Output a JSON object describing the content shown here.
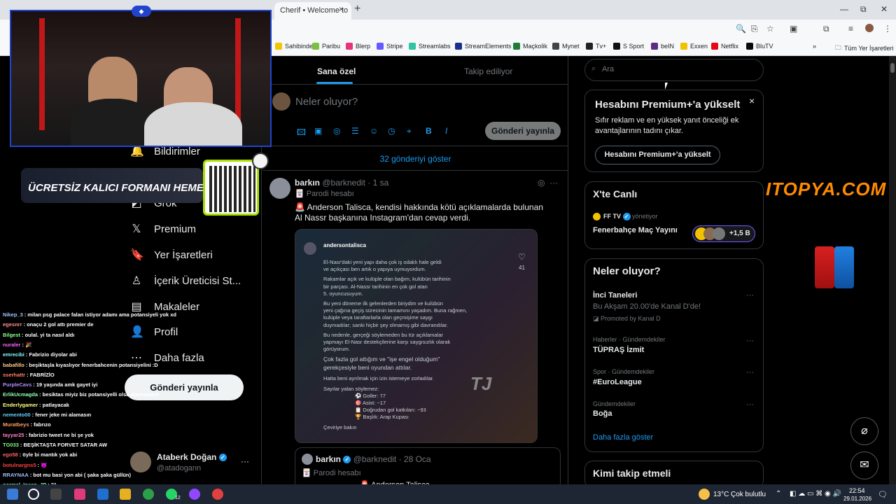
{
  "browser": {
    "tab_title": "Cherif • Welcome to",
    "tab_close": "×",
    "new_tab": "+",
    "window_min": "—",
    "window_max": "⧉",
    "window_close": "✕",
    "bookmarks": [
      {
        "label": "Sahibinden",
        "color": "#f5c400"
      },
      {
        "label": "Paribu",
        "color": "#7bc043"
      },
      {
        "label": "Blerp",
        "color": "#e6337a"
      },
      {
        "label": "Stripe",
        "color": "#635bff"
      },
      {
        "label": "Streamlabs",
        "color": "#31c3a2"
      },
      {
        "label": "StreamElements",
        "color": "#1a2f8a"
      },
      {
        "label": "Maçkolik",
        "color": "#1f7a3a"
      },
      {
        "label": "Mynet",
        "color": "#444"
      },
      {
        "label": "Tv+",
        "color": "#222"
      },
      {
        "label": "S Sport",
        "color": "#111"
      },
      {
        "label": "beIN",
        "color": "#5a2d82"
      },
      {
        "label": "Exxen",
        "color": "#f2c200"
      },
      {
        "label": "Netflix",
        "color": "#e50914"
      },
      {
        "label": "BluTV",
        "color": "#0a0a0a"
      }
    ],
    "bookmarks_more": "»",
    "all_bookmarks": "Tüm Yer İşaretleri"
  },
  "nav": {
    "items": [
      {
        "label": "Bildirimler",
        "icon": "bell-icon",
        "glyph": "🔔"
      },
      {
        "label": "Grok",
        "icon": "grok-icon",
        "glyph": "◩"
      },
      {
        "label": "Premium",
        "icon": "x-logo-icon",
        "glyph": "𝕏"
      },
      {
        "label": "Yer İşaretleri",
        "icon": "bookmark-icon",
        "glyph": "🔖"
      },
      {
        "label": "İçerik Üreticisi St...",
        "icon": "creator-icon",
        "glyph": "♙"
      },
      {
        "label": "Makaleler",
        "icon": "article-icon",
        "glyph": "▤"
      },
      {
        "label": "Profil",
        "icon": "person-icon",
        "glyph": "👤"
      },
      {
        "label": "Daha fazla",
        "icon": "more-icon",
        "glyph": "⋯"
      }
    ],
    "post_button": "Gönderi yayınla",
    "account_name": "Ataberk Doğan",
    "account_handle": "@atadogann"
  },
  "main": {
    "tabs": [
      "Sana özel",
      "Takip ediliyor"
    ],
    "compose_placeholder": "Neler oluyor?",
    "compose_button": "Gönderi yayınla",
    "show_posts": "32 gönderiyi göster",
    "tweet": {
      "name": "barkın",
      "handle": "@barknedit",
      "time": "· 1 sa",
      "badge": "🃏 Parodi hesabı",
      "text": "🚨 Anderson Talisca, kendisi hakkında kötü açıklamalarda bulunan Al Nassr başkanına Instagram'dan cevap verdi.",
      "media_user": "andersontalisca",
      "media_likes": "41",
      "media_lines": [
        "El-Nasr'daki yeni yapı daha çok iş odaklı hale geldi",
        "ve açıkçası ben artık o yapıya uymuyordum.",
        "Rakamlar açık ve kulüple olan bağım, kulübün tarihinin",
        "bir parçası. Al-Nassr tarihinin en çok gol atan",
        "5. oyuncusuyum.",
        "Bu yeni döneme ilk gelenlerden biriydim ve kulübün",
        "yeni çağına geçiş sürecinin tamamını yaşadım. Buna rağmen,",
        "kulüple veya taraftarlarla olan geçmişime saygı",
        "duymadılar; sanki hiçbir şey olmamış gibi davrandılar.",
        "Bu nedenle, gerçeği söylemeden bu tür açıklamalar",
        "yapmayı El-Nasr destekçilerine karşı saygısızlık olarak",
        "görüyorum.",
        "Çok fazla gol attığım ve \"işe engel olduğum\"",
        "gerekçesiyle beni oyundan attılar.",
        "Hatta beni ayrılmak için izin istemeye zorladılar.",
        "Sayılar yalan söylemez:",
        "⚽ Goller: 77",
        "🎯 Asist: ~17",
        "📋 Doğrudan gol katkıları: ~93",
        "🏆 Başlık: Arap Kupası",
        "Çeviriye bakın"
      ],
      "media_watermark": "TJ"
    },
    "quote": {
      "name": "barkın",
      "handle": "@barknedit · 28 Oca",
      "badge": "🃏 Parodi hesabı",
      "preview": "🚨 Anderson Talisca..."
    }
  },
  "right": {
    "search_placeholder": "Ara",
    "premium": {
      "title": "Hesabını Premium+'a yükselt",
      "text": "Sıfır reklam ve en yüksek yanıt önceliği ek avantajlarının tadını çıkar.",
      "button": "Hesabını Premium+'a yükselt",
      "close": "×"
    },
    "live": {
      "title": "X'te Canlı",
      "host": "FF TV",
      "host_role": "yönetiyor",
      "stream_title": "Fenerbahçe Maç Yayını",
      "listeners": "+1,5 B"
    },
    "trends": {
      "title": "Neler oluyor?",
      "items": [
        {
          "meta": "",
          "name": "İnci Taneleri",
          "sub": "Bu Akşam 20.00'de Kanal D'de!",
          "promo": "Promoted by Kanal D"
        },
        {
          "meta": "Haberler · Gündemdekiler",
          "name": "TÜPRAŞ İzmit"
        },
        {
          "meta": "Spor · Gündemdekiler",
          "name": "#EuroLeague"
        },
        {
          "meta": "Gündemdekiler",
          "name": "Boğa"
        }
      ],
      "more": "Daha fazla göster"
    },
    "follow_title": "Kimi takip etmeli"
  },
  "overlay": {
    "banner": "ÜCRETSİZ KALICI FORMANI HEMEN AL",
    "sponsor": "ITOPYA.COM",
    "chat": [
      {
        "user": "Nikep_3",
        "color": "#a0c8ff",
        "msg": ": milan psg palace falan istiyor adamı ama potansiyeli yok xd"
      },
      {
        "user": "egesnrr",
        "color": "#ff9090",
        "msg": ": onaçu 2 gol attı premier de"
      },
      {
        "user": "Bilgest",
        "color": "#90ff90",
        "msg": ": oulal. yi ta nasıl aldı"
      },
      {
        "user": "nuraler",
        "color": "#ff60ff",
        "msg": ": 🎉"
      },
      {
        "user": "emrecibi",
        "color": "#80ffff",
        "msg": ": Fabrizio diyolar abi"
      },
      {
        "user": "babafillo",
        "color": "#ffd080",
        "msg": ": beşiktaşla kıyaslıyor fenerbahcenin potansiyelini :D"
      },
      {
        "user": "sserhattr",
        "color": "#ff8060",
        "msg": ": FABRİZİO"
      },
      {
        "user": "PurpleCavs",
        "color": "#b090ff",
        "msg": ": 19 yaşında amk gayet iyi"
      },
      {
        "user": "ErlikUcmagda",
        "color": "#90ffb0",
        "msg": ": besiktas miyiz biz potansiyelli olsa alamayalım"
      },
      {
        "user": "Enderlygamer",
        "color": "#ffff80",
        "msg": ": patlayacak"
      },
      {
        "user": "nemento00",
        "color": "#60d0ff",
        "msg": ": fener jeke mi alamasın"
      },
      {
        "user": "Muratbeys",
        "color": "#ff9f60",
        "msg": ": fabrızo"
      },
      {
        "user": "tayyar25",
        "color": "#ff80c0",
        "msg": ": fabrizio tweet ne bi şe yok"
      },
      {
        "user": "TG033",
        "color": "#80ff80",
        "msg": ": BEŞİKTAŞTA FORVET SATAR AW"
      },
      {
        "user": "ego58",
        "color": "#ff6060",
        "msg": ": öyle bi mantık yok abi"
      },
      {
        "user": "botulnargns5",
        "color": "#ff4040",
        "msg": ": 😈"
      },
      {
        "user": "RRAYNAA",
        "color": "#a0c0ff",
        "msg": ": bot mu basi yon abi ( şaka şaka güllün)"
      },
      {
        "user": "normal_Insan_JP",
        "color": "#80ffc0",
        "msg": ": 31"
      }
    ]
  },
  "taskbar": {
    "weather_temp": "13°C",
    "weather_text": "Çok bulutlu",
    "time": "22:54",
    "date": "29.01.2026",
    "badge_count": "12"
  }
}
